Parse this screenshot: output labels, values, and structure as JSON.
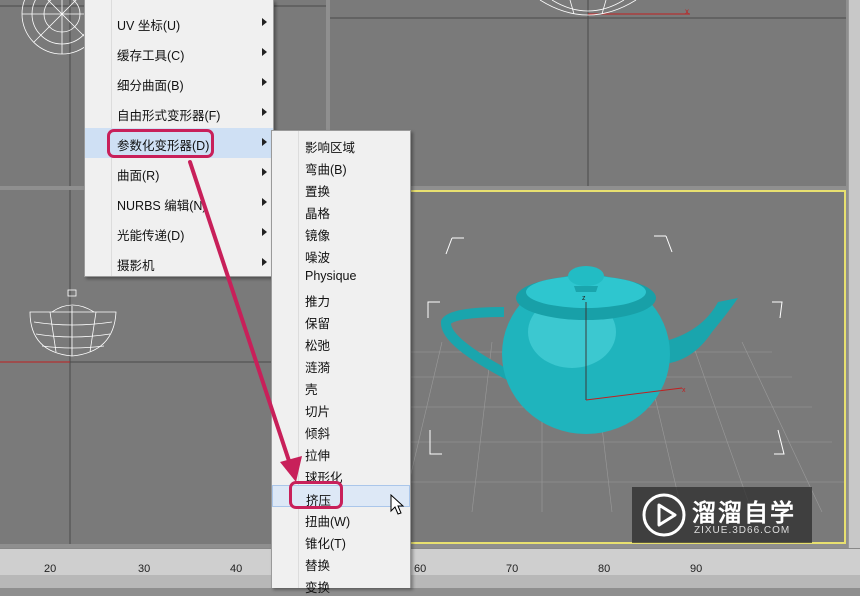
{
  "main_menu": {
    "items": [
      {
        "label": "UV 坐标(U)"
      },
      {
        "label": "缓存工具(C)"
      },
      {
        "label": "细分曲面(B)"
      },
      {
        "label": "自由形式变形器(F)"
      },
      {
        "label": "参数化变形器(D)"
      },
      {
        "label": "曲面(R)"
      },
      {
        "label": "NURBS 编辑(N)"
      },
      {
        "label": "光能传递(D)"
      },
      {
        "label": "摄影机"
      }
    ]
  },
  "submenu": {
    "items": [
      {
        "label": "影响区域"
      },
      {
        "label": "弯曲(B)"
      },
      {
        "label": "置换"
      },
      {
        "label": "晶格"
      },
      {
        "label": "镜像"
      },
      {
        "label": "噪波"
      },
      {
        "label": "Physique"
      },
      {
        "label": "推力"
      },
      {
        "label": "保留"
      },
      {
        "label": "松弛"
      },
      {
        "label": "涟漪"
      },
      {
        "label": "壳"
      },
      {
        "label": "切片"
      },
      {
        "label": "倾斜"
      },
      {
        "label": "拉伸"
      },
      {
        "label": "球形化"
      },
      {
        "label": "挤压"
      },
      {
        "label": "扭曲(W)"
      },
      {
        "label": "锥化(T)"
      },
      {
        "label": "替换"
      },
      {
        "label": "变换"
      }
    ]
  },
  "timeline": {
    "ticks": [
      "20",
      "30",
      "40",
      "60",
      "70",
      "80",
      "90"
    ]
  },
  "watermark": {
    "title": "溜溜自学",
    "url": "ZIXUE.3D66.COM"
  },
  "colors": {
    "viewport_bg": "#7a7a7a",
    "teapot": "#1fb4bd",
    "active_border": "#e8e070",
    "highlight_callout": "#c8205a",
    "axis_red": "#c02020"
  }
}
